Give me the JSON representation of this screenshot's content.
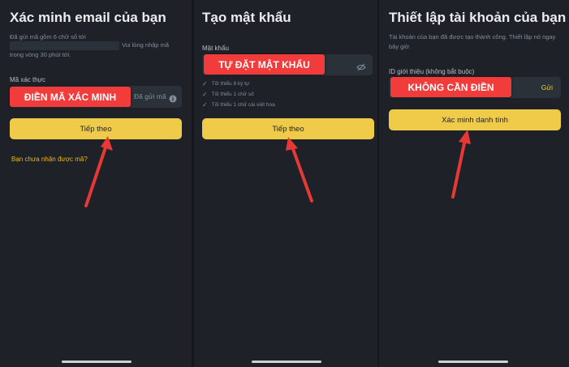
{
  "panel1": {
    "title": "Xác minh email của bạn",
    "sent_line1": "Đã gửi mã gồm 6 chữ số tới",
    "sent_line2_tail": "Vui lòng nhập mã",
    "sent_line3": "trong vòng 30 phút tới.",
    "code_label": "Mã xác thực",
    "code_overlay": "ĐIỀN MÃ XÁC MINH",
    "resend_label": "Đã gửi mã",
    "continue_button": "Tiếp theo",
    "not_received_link": "Bạn chưa nhận được mã?"
  },
  "panel2": {
    "title": "Tạo mật khẩu",
    "password_label": "Mật khẩu",
    "password_overlay": "TỰ ĐẶT MẬT KHẨU",
    "rules": [
      "Tối thiểu 8 ký tự",
      "Tối thiểu 1 chữ số",
      "Tối thiểu 1 chữ cái viết hoa"
    ],
    "continue_button": "Tiếp theo"
  },
  "panel3": {
    "title": "Thiết lập tài khoản của bạn",
    "desc_line1": "Tài khoản của bạn đã được tạo thành công. Thiết lập nó ngay",
    "desc_line2": "bây giờ.",
    "referral_label": "ID giới thiệu (không bắt buộc)",
    "referral_overlay": "KHÔNG CẦN ĐIỀN",
    "send_label": "Gửi",
    "verify_button": "Xác minh danh tính"
  },
  "colors": {
    "background": "#1e2127",
    "accent_yellow": "#f0cb4a",
    "overlay_red": "#f23b3b",
    "link_yellow": "#f0b90b",
    "arrow_red": "#e53935"
  },
  "icons": [
    "info-icon",
    "eye-off-icon",
    "check-icon",
    "red-arrow-icon"
  ]
}
